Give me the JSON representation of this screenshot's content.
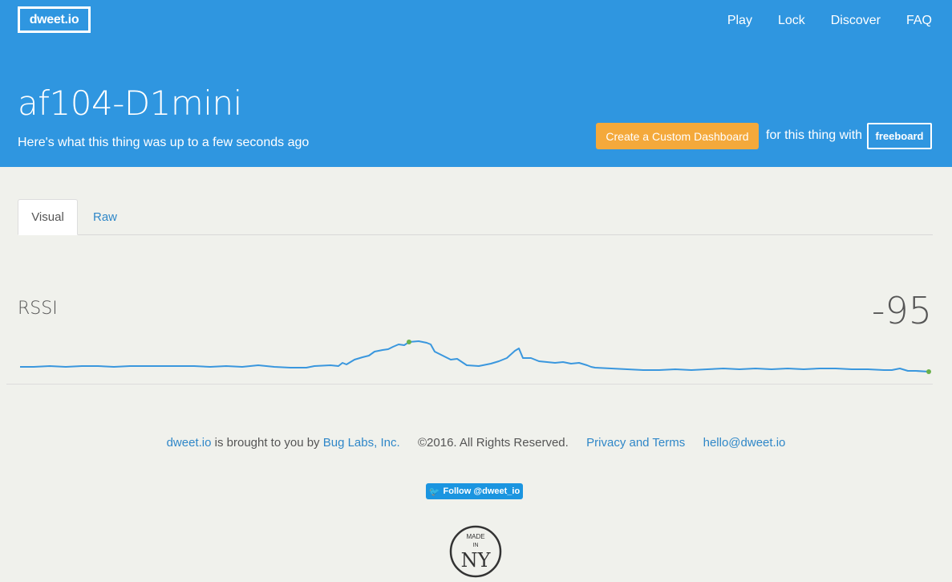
{
  "header": {
    "logo": "dweet.io",
    "nav": [
      "Play",
      "Lock",
      "Discover",
      "FAQ"
    ],
    "thing_name": "af104-D1mini",
    "subtitle": "Here's what this thing was up to a few seconds ago",
    "dashboard_button": "Create a Custom Dashboard",
    "dashboard_text": "for this thing with",
    "freeboard_button": "freeboard"
  },
  "tabs": {
    "visual": "Visual",
    "raw": "Raw"
  },
  "metric": {
    "label": "RSSI",
    "value": "-95"
  },
  "colors": {
    "header_bg": "#2f96e0",
    "accent_orange": "#f4a93b",
    "link": "#2f87c8",
    "spark_line": "#3a97de",
    "spark_dot": "#6ab04c"
  },
  "footer": {
    "dweet_link": "dweet.io",
    "brought_text": "is brought to you by",
    "buglabs_link": "Bug Labs, Inc.",
    "copyright": "©2016. All Rights Reserved.",
    "privacy_link": "Privacy and Terms",
    "email_link": "hello@dweet.io",
    "twitter_label": "Follow @dweet_io",
    "badge_top": "MADE",
    "badge_in": "IN",
    "badge_ny": "NY"
  }
}
